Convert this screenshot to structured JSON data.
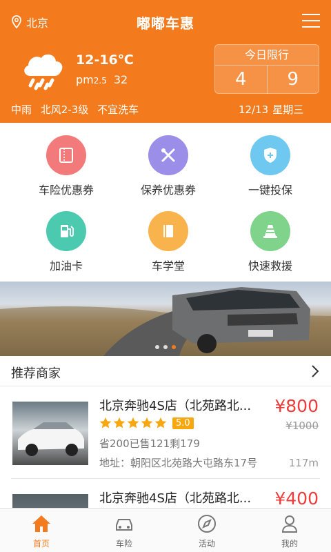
{
  "header": {
    "location": "北京",
    "title": "嘟嘟车惠",
    "temperature": "12-16℃",
    "pm_label": "pm",
    "pm_sub": "2.5",
    "pm_value": "32",
    "weather": [
      "中雨",
      "北风2-3级",
      "不宜洗车"
    ],
    "limit": {
      "title": "今日限行",
      "numbers": [
        "4",
        "9"
      ]
    },
    "date": "12/13",
    "weekday": "星期三"
  },
  "services": [
    {
      "label": "车险优惠券",
      "color": "#f37a7a",
      "icon": "ticket-icon"
    },
    {
      "label": "保养优惠券",
      "color": "#9a8ee8",
      "icon": "tools-icon"
    },
    {
      "label": "一键投保",
      "color": "#6fc8ef",
      "icon": "shield-icon"
    },
    {
      "label": "加油卡",
      "color": "#4bcab0",
      "icon": "fuel-icon"
    },
    {
      "label": "车学堂",
      "color": "#f8b34c",
      "icon": "book-icon"
    },
    {
      "label": "快速救援",
      "color": "#7fd38a",
      "icon": "cone-icon"
    }
  ],
  "banner": {
    "dots": 3,
    "active_index": 2
  },
  "section": {
    "title": "推荐商家"
  },
  "shops": [
    {
      "name": "北京奔驰4S店（北苑路北...",
      "rating": "5.0",
      "stars": 5,
      "sold": "省200已售121剩179",
      "address": "地址：朝阳区北苑路大屯路东17号",
      "price": "¥800",
      "old_price": "¥1000",
      "distance": "117m"
    },
    {
      "name": "北京奔驰4S店（北苑路北...",
      "price": "¥400"
    }
  ],
  "tabs": [
    {
      "label": "首页",
      "icon": "home-icon",
      "active": true
    },
    {
      "label": "车险",
      "icon": "car-icon",
      "active": false
    },
    {
      "label": "活动",
      "icon": "compass-icon",
      "active": false
    },
    {
      "label": "我的",
      "icon": "user-icon",
      "active": false
    }
  ],
  "colors": {
    "brand": "#f37b1d",
    "price": "#ee3b3b",
    "rating_badge": "#f7a70f"
  }
}
